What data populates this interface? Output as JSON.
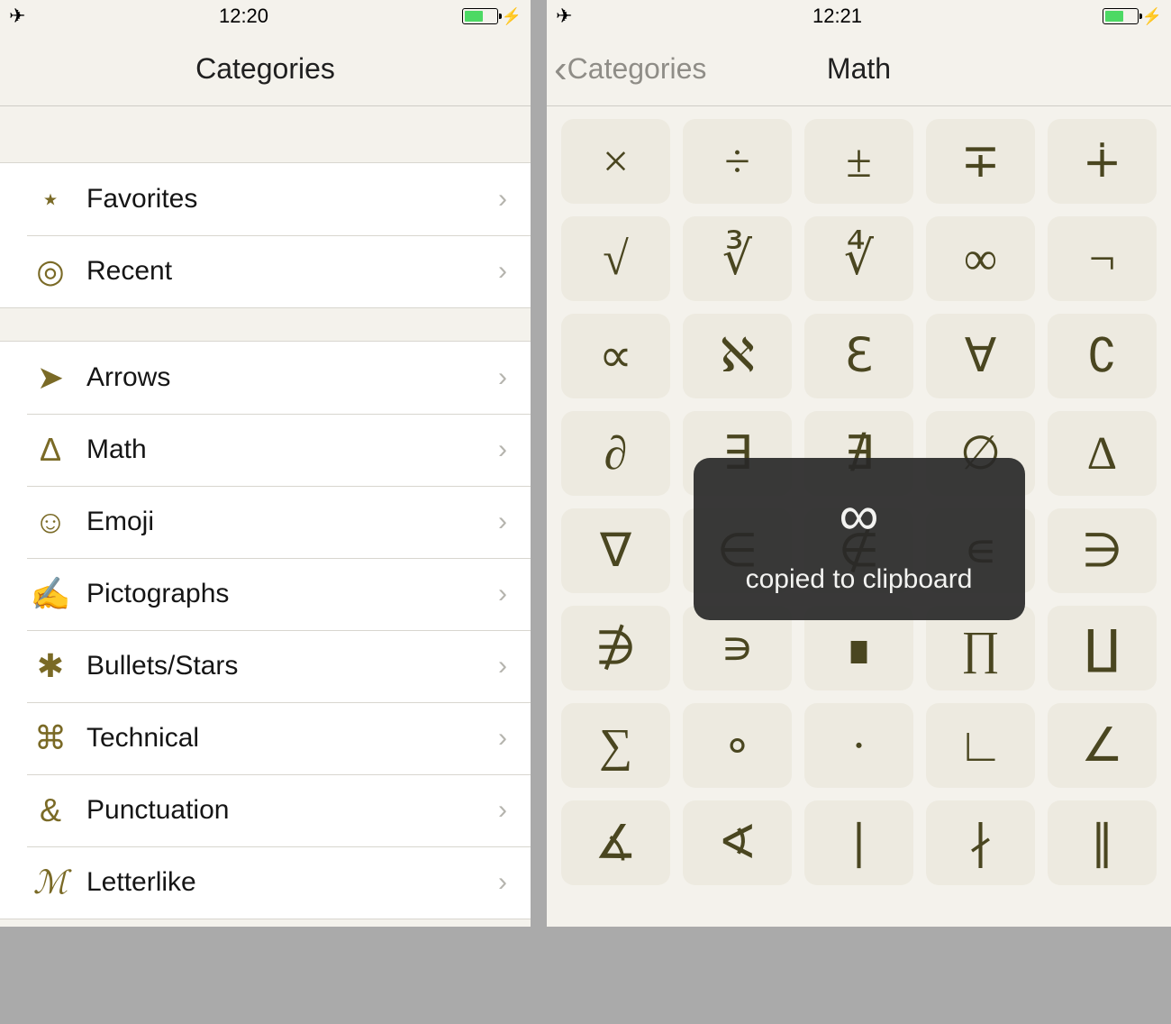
{
  "left": {
    "status": {
      "time": "12:20"
    },
    "title": "Categories",
    "group1": [
      {
        "icon": "⋆",
        "label": "Favorites"
      },
      {
        "icon": "◎",
        "label": "Recent"
      }
    ],
    "group2": [
      {
        "icon": "➤",
        "label": "Arrows"
      },
      {
        "icon": "Δ",
        "label": "Math"
      },
      {
        "icon": "☺",
        "label": "Emoji"
      },
      {
        "icon": "✍",
        "label": "Pictographs"
      },
      {
        "icon": "✱",
        "label": "Bullets/Stars"
      },
      {
        "icon": "⌘",
        "label": "Technical"
      },
      {
        "icon": "&",
        "label": "Punctuation"
      },
      {
        "icon": "ℳ",
        "label": "Letterlike"
      }
    ]
  },
  "right": {
    "status": {
      "time": "12:21"
    },
    "back": "Categories",
    "title": "Math",
    "tiles": [
      "×",
      "÷",
      "±",
      "∓",
      "∔",
      "√",
      "∛",
      "∜",
      "∞",
      "¬",
      "∝",
      "ℵ",
      "ℇ",
      "∀",
      "∁",
      "∂",
      "∃",
      "∄",
      "∅",
      "∆",
      "∇",
      "∈",
      "∉",
      "∊",
      "∋",
      "∌",
      "∍",
      "∎",
      "∏",
      "∐",
      "∑",
      "∘",
      "∙",
      "∟",
      "∠",
      "∡",
      "∢",
      "∣",
      "∤",
      "∥"
    ],
    "toast": {
      "symbol": "∞",
      "message": "copied to clipboard"
    }
  }
}
